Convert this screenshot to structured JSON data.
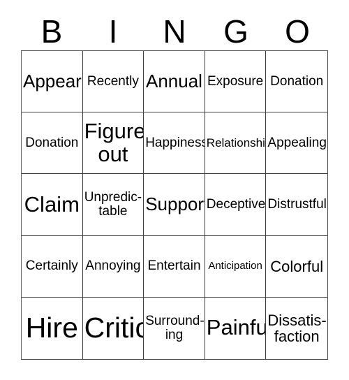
{
  "card": {
    "title_letters": [
      "B",
      "I",
      "N",
      "G",
      "O"
    ],
    "columns": 5,
    "rows": 5,
    "grid_color": "#3d3d3d",
    "text_color": "#000000",
    "background": "#ffffff",
    "cells": [
      {
        "text": "Appear",
        "size": "fs-xl"
      },
      {
        "text": "Recently",
        "size": "fs-md"
      },
      {
        "text": "Annual",
        "size": "fs-xl"
      },
      {
        "text": "Exposure",
        "size": "fs-md"
      },
      {
        "text": "Donation",
        "size": "fs-md"
      },
      {
        "text": "Donation",
        "size": "fs-md"
      },
      {
        "text": "Figure\nout",
        "size": "fs-xxl"
      },
      {
        "text": "Happiness",
        "size": "fs-md"
      },
      {
        "text": "Relationship",
        "size": "fs-sm"
      },
      {
        "text": "Appealing",
        "size": "fs-md"
      },
      {
        "text": "Claim",
        "size": "fs-xxl"
      },
      {
        "text": "Unpredic-\ntable",
        "size": "fs-md"
      },
      {
        "text": "Support",
        "size": "fs-xl"
      },
      {
        "text": "Deceptive",
        "size": "fs-md"
      },
      {
        "text": "Distrustful",
        "size": "fs-md"
      },
      {
        "text": "Certainly",
        "size": "fs-md"
      },
      {
        "text": "Annoying",
        "size": "fs-md"
      },
      {
        "text": "Entertain",
        "size": "fs-md"
      },
      {
        "text": "Anticipation",
        "size": "fs-xs"
      },
      {
        "text": "Colorful",
        "size": "fs-lg"
      },
      {
        "text": "Hire",
        "size": "fs-huge"
      },
      {
        "text": "Critic",
        "size": "fs-huge"
      },
      {
        "text": "Surround-\ning",
        "size": "fs-md"
      },
      {
        "text": "Painful",
        "size": "fs-xxl"
      },
      {
        "text": "Dissatis-\nfaction",
        "size": "fs-lg"
      }
    ]
  }
}
